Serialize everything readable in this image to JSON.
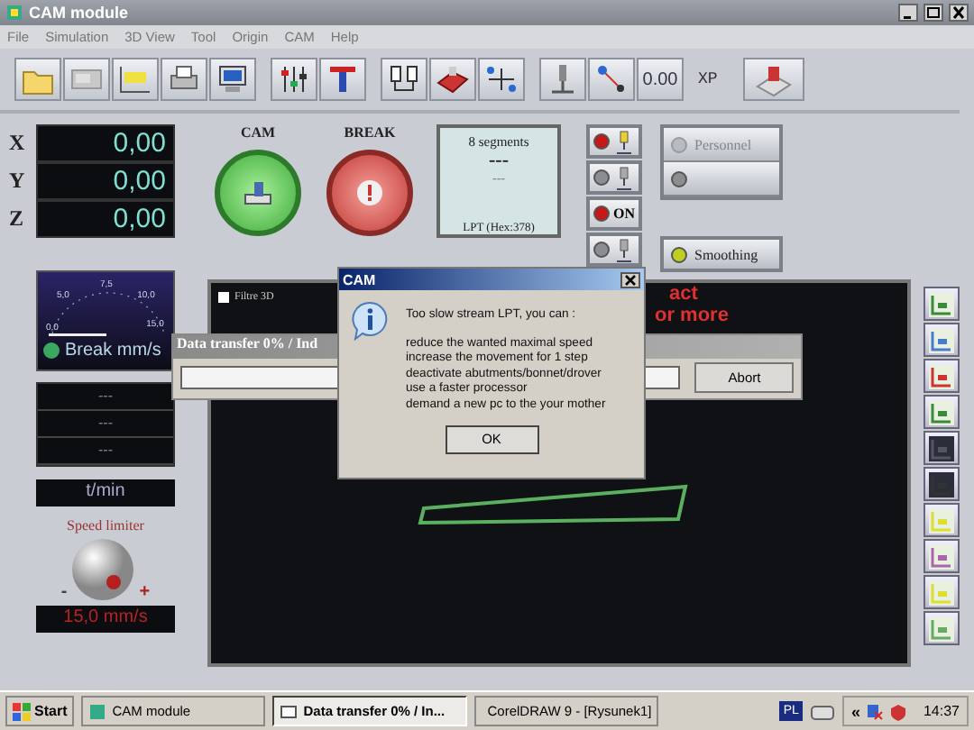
{
  "window": {
    "title": "CAM module"
  },
  "menu": [
    "File",
    "Simulation",
    "3D View",
    "Tool",
    "Origin",
    "CAM",
    "Help"
  ],
  "toolbar": {
    "value_button": "0.00",
    "label": "XP"
  },
  "axes": [
    {
      "axis": "X",
      "value": "0,00"
    },
    {
      "axis": "Y",
      "value": "0,00"
    },
    {
      "axis": "Z",
      "value": "0,00"
    }
  ],
  "cam_buttons": [
    {
      "label": "CAM",
      "kind": "start"
    },
    {
      "label": "BREAK",
      "kind": "stop"
    }
  ],
  "segments": {
    "title": "8 segments",
    "value": "---",
    "sub": "---",
    "port": "LPT (Hex:378)"
  },
  "indicators": [
    {
      "kind": "icon",
      "on": true
    },
    {
      "kind": "icon",
      "on": false
    },
    {
      "kind": "text",
      "label": "ON",
      "on": true
    },
    {
      "kind": "icon",
      "on": false
    }
  ],
  "options": [
    {
      "kind": "labeled",
      "label": "Personnel",
      "disabled": true
    },
    {
      "kind": "blank",
      "disabled": false
    }
  ],
  "smoothing": {
    "label": "Smoothing",
    "on": true
  },
  "gauge": {
    "label": "Break mm/s",
    "active": true,
    "ticks": [
      "0,0",
      "5,0",
      "7,5",
      "10,0",
      "15,0"
    ]
  },
  "readouts": [
    "---",
    "---",
    "---"
  ],
  "rpm": "t/min",
  "speed_limiter": {
    "label": "Speed limiter",
    "minus": "-",
    "plus": "+",
    "value": "15,0 mm/s"
  },
  "canvas": {
    "filter_label": "Filtre 3D",
    "filter_checked": false,
    "message_lines": [
      "act",
      "or more"
    ]
  },
  "transfer": {
    "title": "Data transfer 0% / Ind",
    "level": 0,
    "button": "Abort"
  },
  "dialog": {
    "title": "CAM",
    "heading": "Too slow stream LPT, you can :",
    "lines": [
      "reduce the wanted maximal speed",
      "increase the movement for 1 step",
      "deactivate abutments/bonnet/drover",
      "use a faster processor",
      "demand a new pc to the your mother"
    ],
    "button": "OK"
  },
  "taskbar": {
    "start": "Start",
    "tasks": [
      {
        "label": "CAM module",
        "selected": false
      },
      {
        "label": "Data transfer 0% / In...",
        "selected": true
      },
      {
        "label": "CorelDRAW 9 - [Rysunek1]",
        "selected": false
      }
    ],
    "language": "PL",
    "tray_expand": "«",
    "clock": "14:37"
  }
}
